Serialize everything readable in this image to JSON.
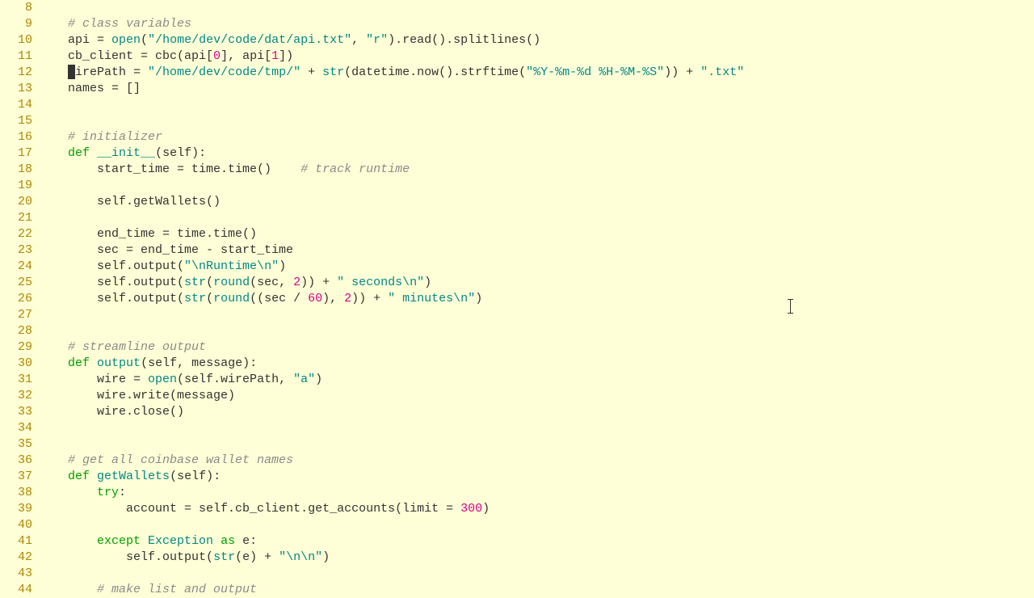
{
  "gutter": {
    "start": 8,
    "end": 44
  },
  "code": {
    "l8": {
      "indent": "    ",
      "segs": []
    },
    "l9": {
      "indent": "    ",
      "segs": [
        {
          "c": "com",
          "t": "# class variables"
        }
      ]
    },
    "l10": {
      "indent": "    ",
      "segs": [
        {
          "c": "txt",
          "t": "api = "
        },
        {
          "c": "fn",
          "t": "open"
        },
        {
          "c": "txt",
          "t": "("
        },
        {
          "c": "str",
          "t": "\"/home/dev/code/dat/api.txt\""
        },
        {
          "c": "txt",
          "t": ", "
        },
        {
          "c": "str",
          "t": "\"r\""
        },
        {
          "c": "txt",
          "t": ").read().splitlines()"
        }
      ]
    },
    "l11": {
      "indent": "    ",
      "segs": [
        {
          "c": "txt",
          "t": "cb_client = cbc(api["
        },
        {
          "c": "num",
          "t": "0"
        },
        {
          "c": "txt",
          "t": "], api["
        },
        {
          "c": "num",
          "t": "1"
        },
        {
          "c": "txt",
          "t": "])"
        }
      ]
    },
    "l12": {
      "indent": "    ",
      "cursor": true,
      "segs": [
        {
          "c": "txt",
          "t": "wirePath = "
        },
        {
          "c": "str",
          "t": "\"/home/dev/code/tmp/\""
        },
        {
          "c": "txt",
          "t": " + "
        },
        {
          "c": "fn",
          "t": "str"
        },
        {
          "c": "txt",
          "t": "(datetime.now().strftime("
        },
        {
          "c": "str",
          "t": "\"%Y-%m-%d %H-%M-%S\""
        },
        {
          "c": "txt",
          "t": ")) + "
        },
        {
          "c": "str",
          "t": "\".txt\""
        }
      ]
    },
    "l13": {
      "indent": "    ",
      "segs": [
        {
          "c": "txt",
          "t": "names = []"
        }
      ]
    },
    "l14": {
      "indent": "",
      "segs": []
    },
    "l15": {
      "indent": "",
      "segs": []
    },
    "l16": {
      "indent": "    ",
      "segs": [
        {
          "c": "com",
          "t": "# initializer"
        }
      ]
    },
    "l17": {
      "indent": "    ",
      "segs": [
        {
          "c": "kw",
          "t": "def"
        },
        {
          "c": "txt",
          "t": " "
        },
        {
          "c": "fn",
          "t": "__init__"
        },
        {
          "c": "txt",
          "t": "(self):"
        }
      ]
    },
    "l18": {
      "indent": "        ",
      "segs": [
        {
          "c": "txt",
          "t": "start_time = time.time()    "
        },
        {
          "c": "com",
          "t": "# track runtime"
        }
      ]
    },
    "l19": {
      "indent": "",
      "segs": []
    },
    "l20": {
      "indent": "        ",
      "segs": [
        {
          "c": "txt",
          "t": "self.getWallets()"
        }
      ]
    },
    "l21": {
      "indent": "",
      "segs": []
    },
    "l22": {
      "indent": "        ",
      "segs": [
        {
          "c": "txt",
          "t": "end_time = time.time()"
        }
      ]
    },
    "l23": {
      "indent": "        ",
      "segs": [
        {
          "c": "txt",
          "t": "sec = end_time - start_time"
        }
      ]
    },
    "l24": {
      "indent": "        ",
      "segs": [
        {
          "c": "txt",
          "t": "self.output("
        },
        {
          "c": "str",
          "t": "\"\\nRuntime\\n\""
        },
        {
          "c": "txt",
          "t": ")"
        }
      ]
    },
    "l25": {
      "indent": "        ",
      "segs": [
        {
          "c": "txt",
          "t": "self.output("
        },
        {
          "c": "fn",
          "t": "str"
        },
        {
          "c": "txt",
          "t": "("
        },
        {
          "c": "fn",
          "t": "round"
        },
        {
          "c": "txt",
          "t": "(sec, "
        },
        {
          "c": "num",
          "t": "2"
        },
        {
          "c": "txt",
          "t": ")) + "
        },
        {
          "c": "str",
          "t": "\" seconds\\n\""
        },
        {
          "c": "txt",
          "t": ")"
        }
      ]
    },
    "l26": {
      "indent": "        ",
      "segs": [
        {
          "c": "txt",
          "t": "self.output("
        },
        {
          "c": "fn",
          "t": "str"
        },
        {
          "c": "txt",
          "t": "("
        },
        {
          "c": "fn",
          "t": "round"
        },
        {
          "c": "txt",
          "t": "((sec / "
        },
        {
          "c": "num",
          "t": "60"
        },
        {
          "c": "txt",
          "t": "), "
        },
        {
          "c": "num",
          "t": "2"
        },
        {
          "c": "txt",
          "t": ")) + "
        },
        {
          "c": "str",
          "t": "\" minutes\\n\""
        },
        {
          "c": "txt",
          "t": ")"
        }
      ]
    },
    "l27": {
      "indent": "",
      "segs": []
    },
    "l28": {
      "indent": "",
      "segs": []
    },
    "l29": {
      "indent": "    ",
      "segs": [
        {
          "c": "com",
          "t": "# streamline output"
        }
      ]
    },
    "l30": {
      "indent": "    ",
      "segs": [
        {
          "c": "kw",
          "t": "def"
        },
        {
          "c": "txt",
          "t": " "
        },
        {
          "c": "fn",
          "t": "output"
        },
        {
          "c": "txt",
          "t": "(self, message):"
        }
      ]
    },
    "l31": {
      "indent": "        ",
      "segs": [
        {
          "c": "txt",
          "t": "wire = "
        },
        {
          "c": "fn",
          "t": "open"
        },
        {
          "c": "txt",
          "t": "(self.wirePath, "
        },
        {
          "c": "str",
          "t": "\"a\""
        },
        {
          "c": "txt",
          "t": ")"
        }
      ]
    },
    "l32": {
      "indent": "        ",
      "segs": [
        {
          "c": "txt",
          "t": "wire.write(message)"
        }
      ]
    },
    "l33": {
      "indent": "        ",
      "segs": [
        {
          "c": "txt",
          "t": "wire.close()"
        }
      ]
    },
    "l34": {
      "indent": "",
      "segs": []
    },
    "l35": {
      "indent": "",
      "segs": []
    },
    "l36": {
      "indent": "    ",
      "segs": [
        {
          "c": "com",
          "t": "# get all coinbase wallet names"
        }
      ]
    },
    "l37": {
      "indent": "    ",
      "segs": [
        {
          "c": "kw",
          "t": "def"
        },
        {
          "c": "txt",
          "t": " "
        },
        {
          "c": "fn",
          "t": "getWallets"
        },
        {
          "c": "txt",
          "t": "(self):"
        }
      ]
    },
    "l38": {
      "indent": "        ",
      "segs": [
        {
          "c": "kw",
          "t": "try"
        },
        {
          "c": "txt",
          "t": ":"
        }
      ]
    },
    "l39": {
      "indent": "            ",
      "segs": [
        {
          "c": "txt",
          "t": "account = self.cb_client.get_accounts(limit = "
        },
        {
          "c": "num",
          "t": "300"
        },
        {
          "c": "txt",
          "t": ")"
        }
      ]
    },
    "l40": {
      "indent": "",
      "segs": []
    },
    "l41": {
      "indent": "        ",
      "segs": [
        {
          "c": "kw",
          "t": "except"
        },
        {
          "c": "txt",
          "t": " "
        },
        {
          "c": "fn",
          "t": "Exception"
        },
        {
          "c": "txt",
          "t": " "
        },
        {
          "c": "kw",
          "t": "as"
        },
        {
          "c": "txt",
          "t": " e:"
        }
      ]
    },
    "l42": {
      "indent": "            ",
      "segs": [
        {
          "c": "txt",
          "t": "self.output("
        },
        {
          "c": "fn",
          "t": "str"
        },
        {
          "c": "txt",
          "t": "(e) + "
        },
        {
          "c": "str",
          "t": "\"\\n\\n\""
        },
        {
          "c": "txt",
          "t": ")"
        }
      ]
    },
    "l43": {
      "indent": "",
      "segs": []
    },
    "l44": {
      "indent": "        ",
      "segs": [
        {
          "c": "com",
          "t": "# make list and output"
        }
      ]
    }
  }
}
